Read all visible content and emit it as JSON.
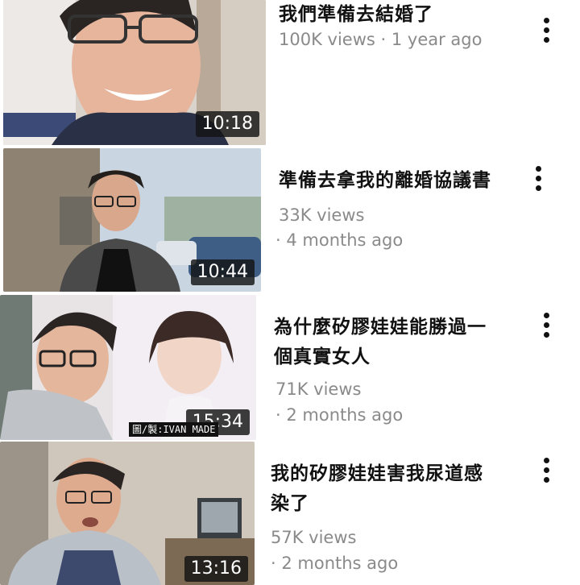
{
  "videos": [
    {
      "title": "我們準備去結婚了",
      "views": "100K views",
      "age": "1 year ago",
      "duration": "10:18"
    },
    {
      "title": "準備去拿我的離婚協議書",
      "views": "33K views",
      "age": "· 4 months ago",
      "duration": "10:44"
    },
    {
      "title_line1": "為什麼矽膠娃娃能勝過一",
      "title_line2": "個真實女人",
      "views": "71K views",
      "age": "· 2 months ago",
      "duration": "15:34"
    },
    {
      "title_line1": "我的矽膠娃娃害我尿道感",
      "title_line2": "染了",
      "views": "57K views",
      "age": "· 2 months ago",
      "duration": "13:16"
    }
  ],
  "credit": "圖/製:IVAN MADE",
  "icons": {
    "more": "more-vert-icon"
  }
}
